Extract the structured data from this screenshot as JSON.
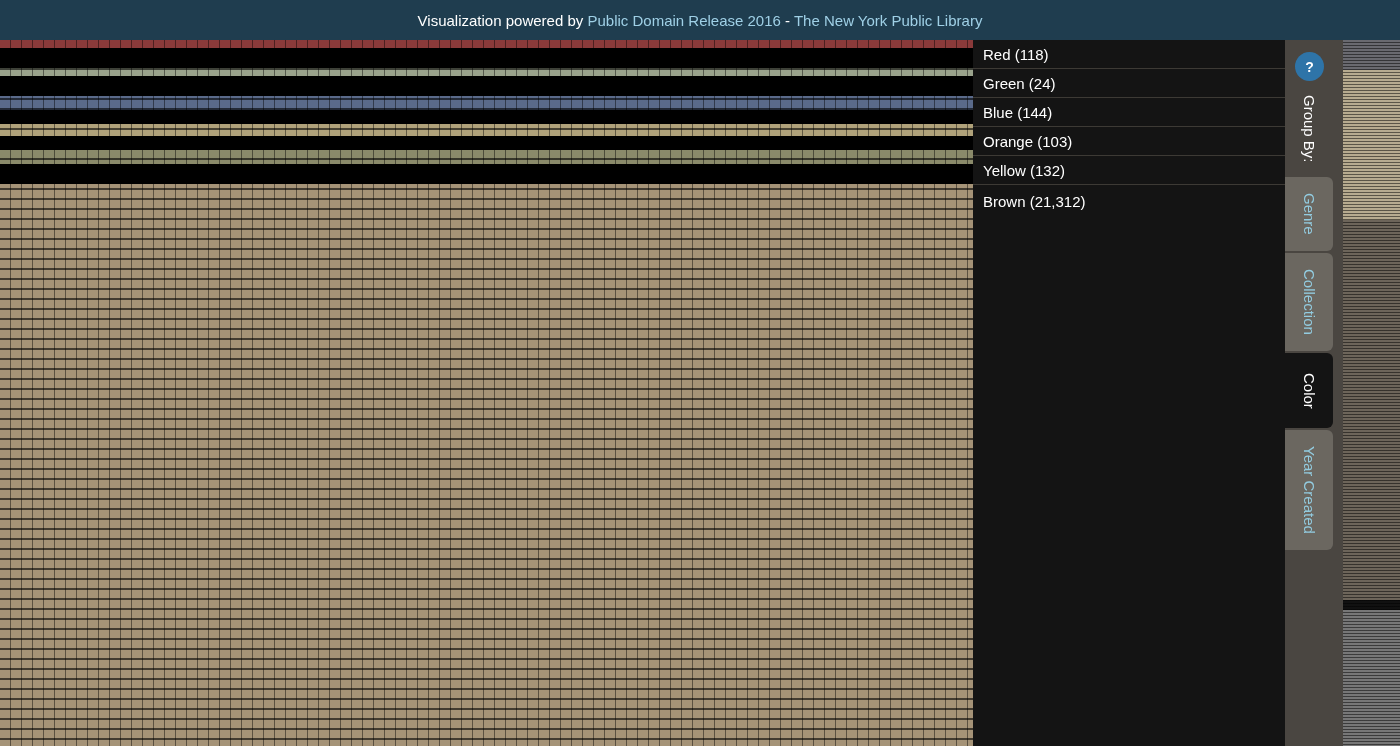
{
  "header": {
    "text": "Visualization powered by",
    "links": [
      "Public Domain Release 2016",
      "The New York Public Library"
    ],
    "separator": "-"
  },
  "groups": [
    {
      "label": "Red (118)"
    },
    {
      "label": "Green (24)"
    },
    {
      "label": "Blue (144)"
    },
    {
      "label": "Orange (103)"
    },
    {
      "label": "Yellow (132)"
    },
    {
      "label": "Brown (21,312)"
    }
  ],
  "help_button": "?",
  "group_by_label": "Group By:",
  "tabs": [
    {
      "label": "Genre",
      "selected": false
    },
    {
      "label": "Collection",
      "selected": false
    },
    {
      "label": "Color",
      "selected": true
    },
    {
      "label": "Year Created",
      "selected": false
    }
  ]
}
